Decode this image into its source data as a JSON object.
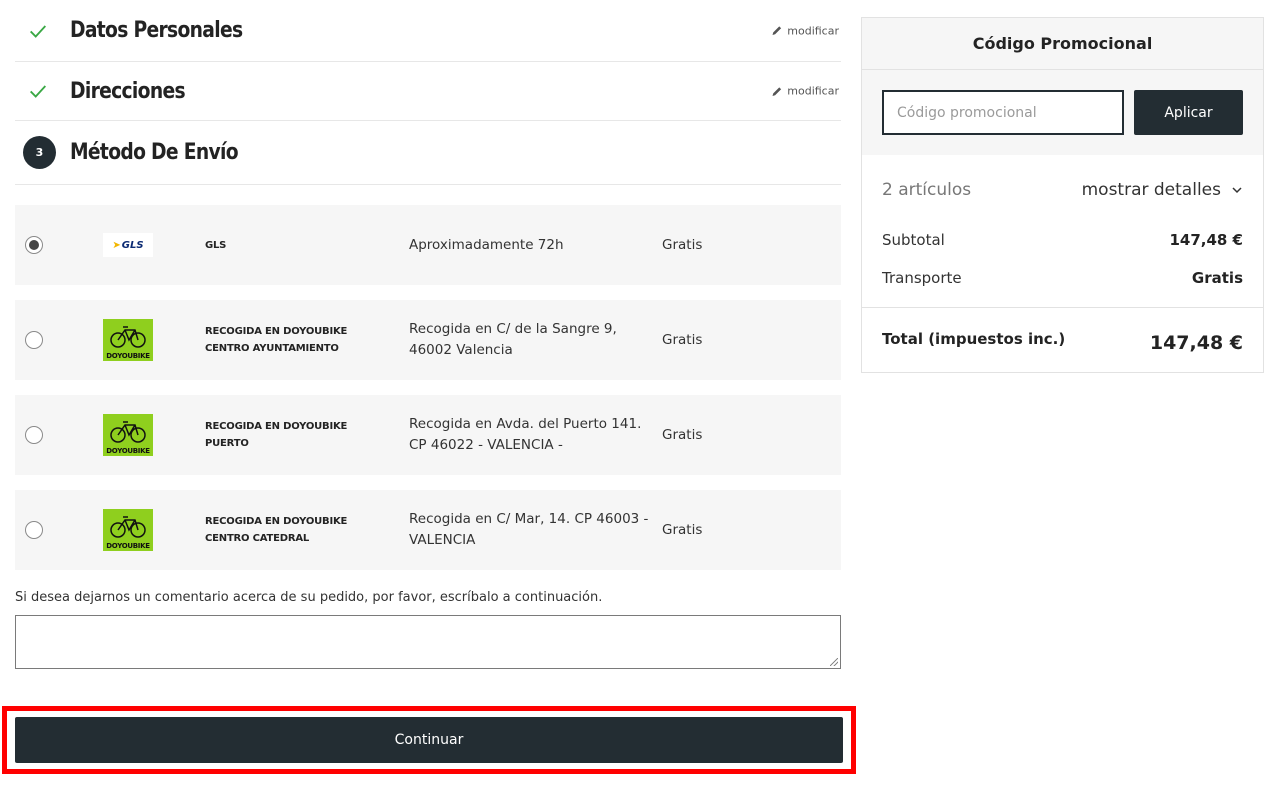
{
  "steps": {
    "personal": {
      "title": "Datos Personales",
      "modify": "modificar"
    },
    "addresses": {
      "title": "Direcciones",
      "modify": "modificar"
    },
    "shipping": {
      "number": "3",
      "title": "Método De Envío"
    }
  },
  "carriers": [
    {
      "logo": "GLS",
      "name": "GLS",
      "delay": "Aproximadamente 72h",
      "price": "Gratis",
      "selected": true
    },
    {
      "logo": "DOYOUBIKE",
      "name": "Recogida en Doyoubike centro Ayuntamiento",
      "delay": "Recogida en C/ de la Sangre 9, 46002 Valencia",
      "price": "Gratis",
      "selected": false
    },
    {
      "logo": "DOYOUBIKE",
      "name": "Recogida en Doyoubike Puerto",
      "delay": "Recogida en Avda. del Puerto 141. CP 46022 - VALENCIA -",
      "price": "Gratis",
      "selected": false
    },
    {
      "logo": "DOYOUBIKE",
      "name": "Recogida en Doyoubike centro Catedral",
      "delay": "Recogida en C/ Mar, 14. CP 46003 - VALENCIA",
      "price": "Gratis",
      "selected": false
    }
  ],
  "comment": {
    "label": "Si desea dejarnos un comentario acerca de su pedido, por favor, escríbalo a continuación.",
    "value": ""
  },
  "continue_label": "Continuar",
  "promo": {
    "title": "Código Promocional",
    "placeholder": "Código promocional",
    "apply_label": "Aplicar"
  },
  "summary": {
    "items_count": "2 artículos",
    "show_details": "mostrar detalles",
    "subtotal_label": "Subtotal",
    "subtotal_value": "147,48 €",
    "shipping_label": "Transporte",
    "shipping_value": "Gratis",
    "total_label": "Total (impuestos inc.)",
    "total_value": "147,48 €"
  },
  "colors": {
    "dark": "#232d33",
    "check": "#3aa845",
    "highlight": "#ff0000",
    "panel_bg": "#f6f6f6"
  }
}
